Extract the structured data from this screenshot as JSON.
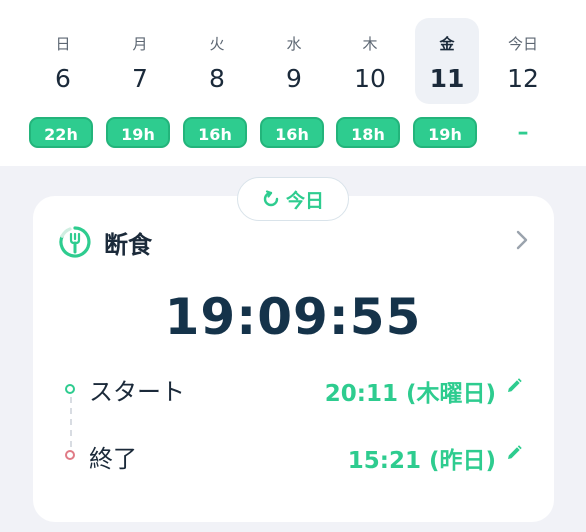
{
  "week": [
    {
      "dow": "日",
      "date": "6",
      "hours": "22h"
    },
    {
      "dow": "月",
      "date": "7",
      "hours": "19h"
    },
    {
      "dow": "火",
      "date": "8",
      "hours": "16h"
    },
    {
      "dow": "水",
      "date": "9",
      "hours": "16h"
    },
    {
      "dow": "木",
      "date": "10",
      "hours": "18h"
    },
    {
      "dow": "金",
      "date": "11",
      "hours": "19h",
      "selected": true
    },
    {
      "dow": "今日",
      "date": "12",
      "hours": "–"
    }
  ],
  "today_chip": {
    "label": "今日"
  },
  "card": {
    "title": "断食",
    "timer": "19:09:55",
    "start": {
      "label": "スタート",
      "value": "20:11 (木曜日)"
    },
    "end": {
      "label": "終了",
      "value": "15:21 (昨日)"
    }
  },
  "colors": {
    "accent": "#2ecc8f",
    "dark_text": "#1b2a3a",
    "end_dot": "#e07b86",
    "background": "#f1f2f7"
  },
  "icons": [
    "fork-ring-icon",
    "refresh-icon",
    "chevron-right-icon",
    "pencil-icon"
  ]
}
